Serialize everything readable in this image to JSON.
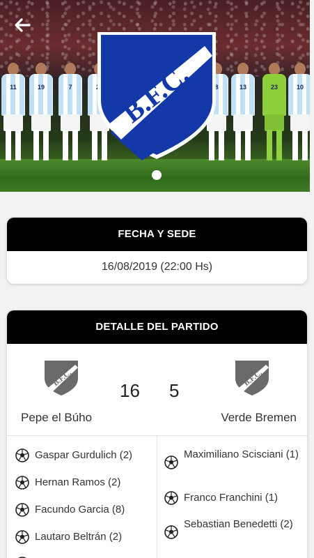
{
  "hero": {
    "logo_text": "B.F.C.",
    "player_numbers": [
      "11",
      "19",
      "7",
      "24",
      "",
      "8",
      "13",
      "23",
      "10"
    ]
  },
  "fecha_sede": {
    "title": "FECHA Y SEDE",
    "datetime": "16/08/2019 (22:00 Hs)"
  },
  "detalle": {
    "title": "DETALLE DEL PARTIDO",
    "home": {
      "name": "Pepe el Búho",
      "score": "16",
      "logo_text": "B.F.C."
    },
    "away": {
      "name": "Verde Bremen",
      "score": "5",
      "logo_text": "B.F.C."
    },
    "home_scorers": [
      "Gaspar Gurdulich (2)",
      "Hernan Ramos (2)",
      "Facundo Garcia (8)",
      "Lautaro Beltrán (2)"
    ],
    "away_scorers": [
      "Maximiliano Scisciani (1)",
      "Franco Franchini (1)",
      "Sebastian Benedetti (2)"
    ]
  },
  "colors": {
    "header_bg": "#000000",
    "crest_blue": "#1338a8",
    "crest_grey": "#6a6a6a",
    "page_bg": "#f2f2f2"
  }
}
